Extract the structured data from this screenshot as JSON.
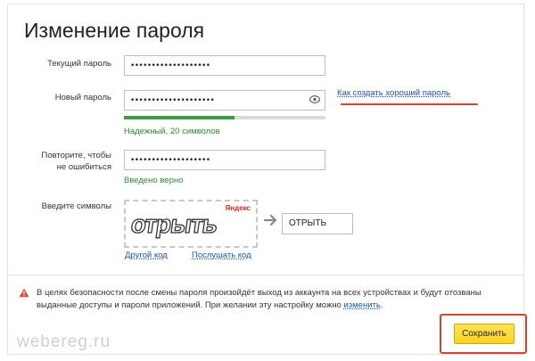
{
  "page": {
    "title": "Изменение пароля"
  },
  "current_password": {
    "label": "Текущий пароль",
    "value": "•••••••••••••••••••"
  },
  "new_password": {
    "label": "Новый пароль",
    "value": "••••••••••••••••••••",
    "strength_fraction": 0.55,
    "strength_text": "Надежный, 20 символов",
    "help_link": "Как создать хороший пароль"
  },
  "repeat_password": {
    "label_line1": "Повторите, чтобы",
    "label_line2": "не ошибиться",
    "value": "•••••••••••••••••••",
    "status": "Введено верно"
  },
  "captcha": {
    "label": "Введите символы",
    "brand": "Яндекс",
    "image_text": "отрыть",
    "input_value": "ОТРЫТЬ",
    "other_code": "Другой код",
    "listen_code": "Послушать код"
  },
  "notice": {
    "text": "В целях безопасности после смены пароля произойдёт выход из аккаунта на всех устройствах и будут отозваны выданные доступы и пароли приложений. При желании эту настройку можно ",
    "link": "изменить",
    "end": "."
  },
  "save_label": "Сохранить",
  "watermark": "webereg.ru",
  "colors": {
    "accent_red": "#d7432f",
    "button_yellow": "#ffd31f",
    "link_blue": "#1a55a8",
    "ok_green": "#2d8a2d"
  }
}
